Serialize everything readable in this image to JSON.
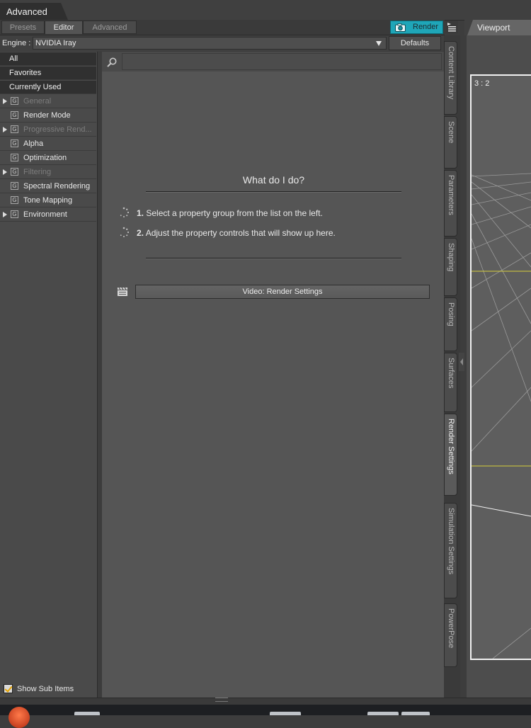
{
  "window": {
    "title": "Advanced"
  },
  "tabs": [
    {
      "label": "Presets",
      "active": false
    },
    {
      "label": "Editor",
      "active": true
    },
    {
      "label": "Advanced",
      "active": false
    }
  ],
  "toolbar": {
    "render_label": "Render",
    "defaults_label": "Defaults"
  },
  "engine": {
    "label": "Engine :",
    "selected": "NVIDIA Iray"
  },
  "left_list": {
    "top_items": [
      "All",
      "Favorites",
      "Currently Used"
    ],
    "groups": [
      {
        "label": "General",
        "expandable": true,
        "enabled": false
      },
      {
        "label": "Render Mode",
        "expandable": false,
        "enabled": true
      },
      {
        "label": "Progressive Rend...",
        "expandable": true,
        "enabled": false
      },
      {
        "label": "Alpha",
        "expandable": false,
        "enabled": true
      },
      {
        "label": "Optimization",
        "expandable": false,
        "enabled": true
      },
      {
        "label": "Filtering",
        "expandable": true,
        "enabled": false
      },
      {
        "label": "Spectral Rendering",
        "expandable": false,
        "enabled": true
      },
      {
        "label": "Tone Mapping",
        "expandable": false,
        "enabled": true
      },
      {
        "label": "Environment",
        "expandable": true,
        "enabled": true
      }
    ],
    "show_sub_items": {
      "label": "Show Sub Items",
      "checked": true
    },
    "group_icon": "G"
  },
  "search": {
    "value": "",
    "placeholder": ""
  },
  "help": {
    "heading": "What do I do?",
    "steps": [
      {
        "num": "1.",
        "text": "Select a property group from the list on the left."
      },
      {
        "num": "2.",
        "text": "Adjust the property controls that will show up here."
      }
    ],
    "video_label": "Video: Render Settings"
  },
  "side_tabs": [
    {
      "label": "Content Library",
      "active": false
    },
    {
      "label": "Scene",
      "active": false
    },
    {
      "label": "Parameters",
      "active": false
    },
    {
      "label": "Shaping",
      "active": false
    },
    {
      "label": "Posing",
      "active": false
    },
    {
      "label": "Surfaces",
      "active": false
    },
    {
      "label": "Render Settings",
      "active": true
    },
    {
      "label": "Simulation Settings",
      "active": false
    },
    {
      "label": "PowerPose",
      "active": false
    }
  ],
  "viewport": {
    "tab_label": "Viewport",
    "aspect_ratio": "3 : 2"
  },
  "colors": {
    "render_accent": "#1fa6b8",
    "checkbox_check": "#e7a400",
    "panel_bg": "#555555"
  }
}
